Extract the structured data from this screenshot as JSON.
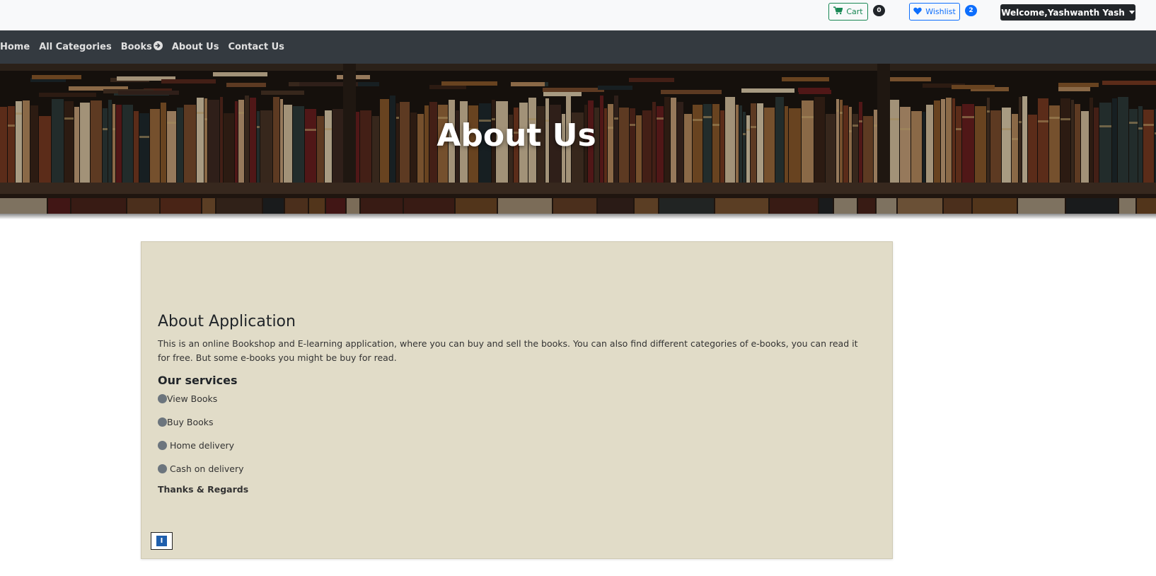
{
  "topbar": {
    "cart_label": "Cart",
    "cart_count": "0",
    "wishlist_label": "Wishlist",
    "wishlist_count": "2",
    "user_label": "Welcome,Yashwanth Yash",
    "cart_icon": "cart-icon",
    "wishlist_icon": "heart-icon",
    "user_menu_icon": "caret-down-icon"
  },
  "nav": {
    "items": [
      {
        "label": "Home"
      },
      {
        "label": "All Categories"
      },
      {
        "label": "Books"
      },
      {
        "label": "About Us"
      },
      {
        "label": "Contact Us"
      }
    ],
    "books_icon": "arrow-circle-right-icon"
  },
  "banner": {
    "title": "About Us"
  },
  "content": {
    "heading": "About Application",
    "description": "This is an online Bookshop and E-learning application, where you can buy and sell the books. You can also find different categories of e-books, you can read it for free. But some e-books you might be buy for read.",
    "services_heading": "Our services",
    "services": [
      {
        "label": "View Books"
      },
      {
        "label": "Buy Books"
      },
      {
        "label": " Home delivery"
      },
      {
        "label": " Cash on delivery"
      }
    ],
    "closing": "Thanks & Regards",
    "info_glyph": "I"
  },
  "colors": {
    "topbar_bg": "#f8f9fa",
    "navbar_bg": "#343a40",
    "card_bg": "#e1dcc8",
    "cart_green": "#198754",
    "wishlist_blue": "#0d6efd",
    "user_dark": "#212529",
    "bullet_gray": "#6c757d"
  }
}
